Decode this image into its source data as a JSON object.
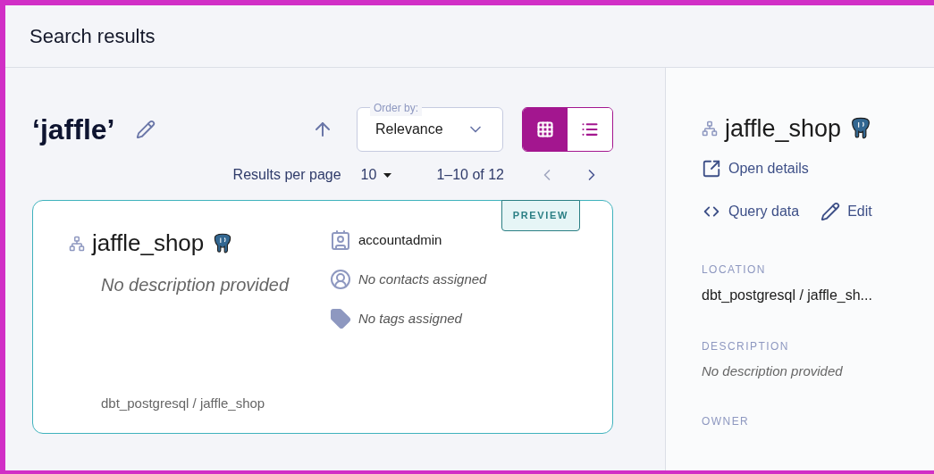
{
  "header": {
    "title": "Search results"
  },
  "query": {
    "text": "‘jaffle’"
  },
  "order_by": {
    "label": "Order by:",
    "value": "Relevance"
  },
  "view_modes": [
    {
      "kind": "grid",
      "selected": true
    },
    {
      "kind": "list",
      "selected": false
    }
  ],
  "pagination": {
    "label": "Results per page",
    "per_page": "10",
    "range": "1–10 of 12"
  },
  "results": [
    {
      "name": "jaffle_shop",
      "badge": "PREVIEW",
      "description": "No description provided",
      "owner": "accountadmin",
      "contacts": "No contacts assigned",
      "tags": "No tags assigned",
      "path": "dbt_postgresql / jaffle_shop"
    }
  ],
  "detail": {
    "name": "jaffle_shop",
    "actions": [
      {
        "kind": "open",
        "label": "Open details"
      },
      {
        "kind": "query",
        "label": "Query data"
      },
      {
        "kind": "edit",
        "label": "Edit"
      }
    ],
    "sections": [
      {
        "heading": "LOCATION",
        "value": "dbt_postgresql / jaffle_sh...",
        "italic": false
      },
      {
        "heading": "DESCRIPTION",
        "value": "No description provided",
        "italic": true
      },
      {
        "heading": "OWNER"
      }
    ]
  }
}
